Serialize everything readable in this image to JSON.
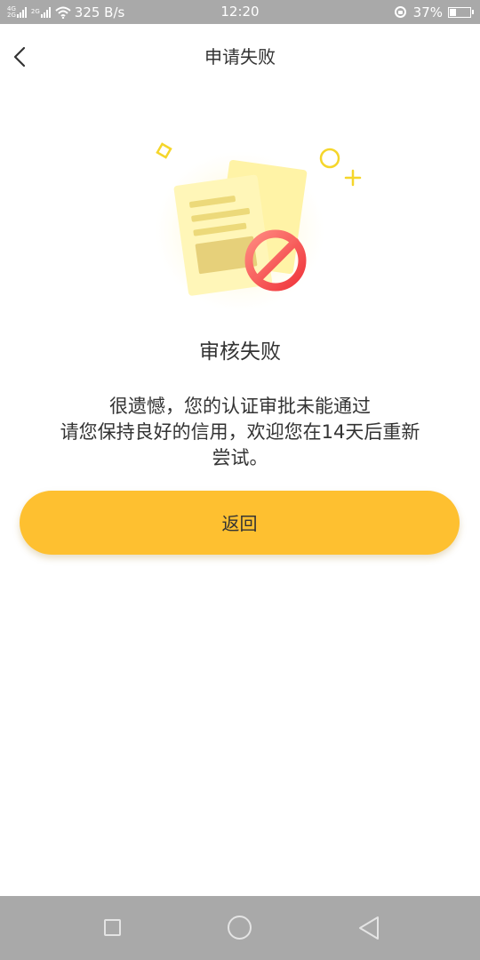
{
  "status_bar": {
    "network_top": "4G",
    "network_bottom": "2G",
    "network2_top": "2G",
    "net_speed": "325 B/s",
    "time": "12:20",
    "battery_percent": "37%",
    "battery_level": 0.37
  },
  "header": {
    "title": "申请失败",
    "back_icon": "chevron-left-icon"
  },
  "illustration": {
    "name": "document-rejected-illustration",
    "accent_color": "#f5464b",
    "paper_color": "#fff3a6"
  },
  "result": {
    "title": "审核失败",
    "message_lines": [
      "很遗憾，您的认证审批未能通过",
      "请您保持良好的信用，欢迎您在14天后重新",
      "尝试。"
    ]
  },
  "actions": {
    "return_label": "返回",
    "button_color": "#fec030"
  },
  "nav_bar": {
    "recent_icon": "square-icon",
    "home_icon": "circle-icon",
    "back_icon": "triangle-back-icon"
  }
}
